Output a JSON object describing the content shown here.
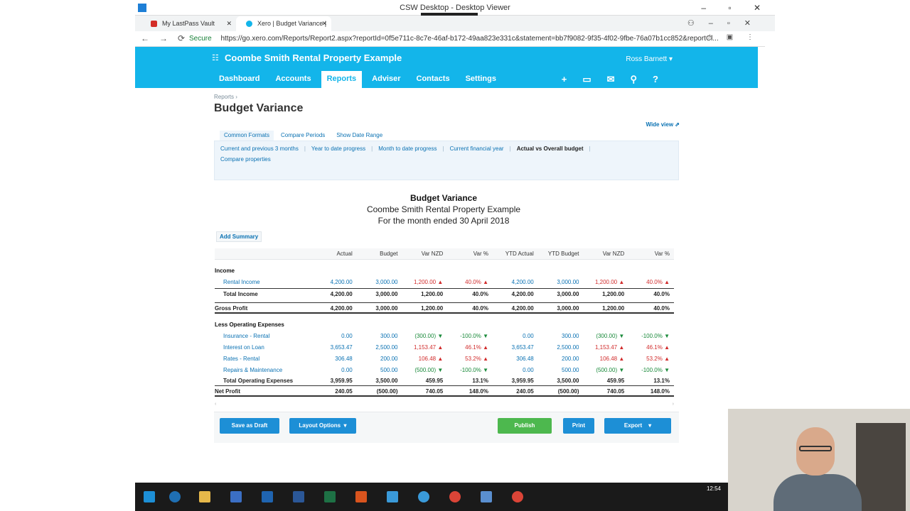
{
  "window": {
    "title": "CSW Desktop - Desktop Viewer",
    "controls": "– ▫ ✕"
  },
  "browser": {
    "tabs": [
      {
        "label": "My LastPass Vault"
      },
      {
        "label": "Xero | Budget Variance |"
      }
    ],
    "secure_label": "Secure",
    "url": "https://go.xero.com/Reports/Report2.aspx?reportId=0f5e711c-8c7e-46af-b172-49aa823e331c&statement=bb7f9082-9f35-4f02-9fbe-76a07b1cc852&reportCl..."
  },
  "xero": {
    "org": "Coombe Smith Rental Property Example",
    "user": "Ross Barnett",
    "nav": [
      "Dashboard",
      "Accounts",
      "Reports",
      "Adviser",
      "Contacts",
      "Settings"
    ]
  },
  "page": {
    "breadcrumb": "Reports ›",
    "title": "Budget Variance",
    "wide_view": "Wide view ⇗",
    "format_tabs": [
      "Common Formats",
      "Compare Periods",
      "Show Date Range"
    ],
    "formats": [
      "Current and previous 3 months",
      "Year to date progress",
      "Month to date progress",
      "Current financial year",
      "Actual vs Overall budget",
      "Compare properties"
    ]
  },
  "report": {
    "title": "Budget Variance",
    "org": "Coombe Smith Rental Property Example",
    "period": "For the month ended 30 April 2018",
    "add_summary": "Add Summary",
    "columns": [
      "",
      "Actual",
      "Budget",
      "Var NZD",
      "Var %",
      "YTD Actual",
      "YTD Budget",
      "Var NZD",
      "Var %"
    ],
    "income_label": "Income",
    "income_rows": [
      {
        "name": "Rental Income",
        "v": [
          "4,200.00",
          "3,000.00",
          "1,200.00 ▲",
          "40.0% ▲",
          "4,200.00",
          "3,000.00",
          "1,200.00 ▲",
          "40.0% ▲"
        ]
      }
    ],
    "total_income": {
      "name": "Total Income",
      "v": [
        "4,200.00",
        "3,000.00",
        "1,200.00",
        "40.0%",
        "4,200.00",
        "3,000.00",
        "1,200.00",
        "40.0%"
      ]
    },
    "gross_profit": {
      "name": "Gross Profit",
      "v": [
        "4,200.00",
        "3,000.00",
        "1,200.00",
        "40.0%",
        "4,200.00",
        "3,000.00",
        "1,200.00",
        "40.0%"
      ]
    },
    "opex_label": "Less Operating Expenses",
    "opex_rows": [
      {
        "name": "Insurance - Rental",
        "v": [
          "0.00",
          "300.00",
          "(300.00) ▼",
          "-100.0% ▼",
          "0.00",
          "300.00",
          "(300.00) ▼",
          "-100.0% ▼"
        ]
      },
      {
        "name": "Interest on Loan",
        "v": [
          "3,653.47",
          "2,500.00",
          "1,153.47 ▲",
          "46.1% ▲",
          "3,653.47",
          "2,500.00",
          "1,153.47 ▲",
          "46.1% ▲"
        ]
      },
      {
        "name": "Rates - Rental",
        "v": [
          "306.48",
          "200.00",
          "106.48 ▲",
          "53.2% ▲",
          "306.48",
          "200.00",
          "106.48 ▲",
          "53.2% ▲"
        ]
      },
      {
        "name": "Repairs & Maintenance",
        "v": [
          "0.00",
          "500.00",
          "(500.00) ▼",
          "-100.0% ▼",
          "0.00",
          "500.00",
          "(500.00) ▼",
          "-100.0% ▼"
        ]
      }
    ],
    "total_opex": {
      "name": "Total Operating Expenses",
      "v": [
        "3,959.95",
        "3,500.00",
        "459.95",
        "13.1%",
        "3,959.95",
        "3,500.00",
        "459.95",
        "13.1%"
      ]
    },
    "net_profit": {
      "name": "Net Profit",
      "v": [
        "240.05",
        "(500.00)",
        "740.05",
        "148.0%",
        "240.05",
        "(500.00)",
        "740.05",
        "148.0%"
      ]
    }
  },
  "buttons": {
    "save_draft": "Save as Draft",
    "layout": "Layout Options",
    "publish": "Publish",
    "print": "Print",
    "export": "Export"
  },
  "taskbar": {
    "time": "12:54"
  }
}
